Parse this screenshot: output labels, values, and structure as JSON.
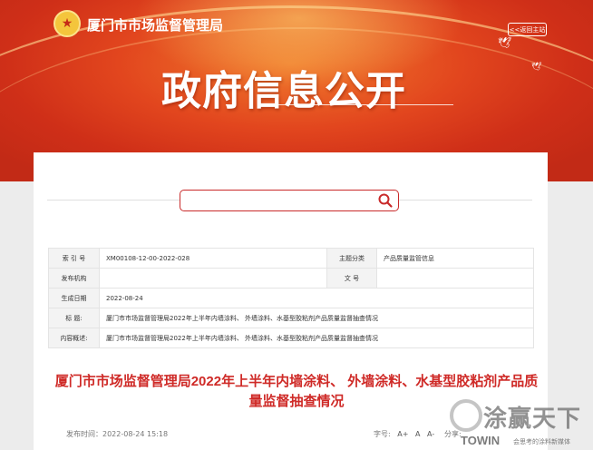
{
  "header": {
    "site_name": "厦门市市场监督管理局",
    "back_label": "<<返回主站",
    "page_title": "政府信息公开"
  },
  "search": {
    "placeholder": ""
  },
  "info_table": {
    "rows": [
      {
        "k1": "索 引 号",
        "v1": "XM00108-12-00-2022-028",
        "k2": "主题分类",
        "v2": "产品质量监管信息"
      },
      {
        "k1": "发布机构",
        "v1": "",
        "k2": "文  号",
        "v2": ""
      },
      {
        "k1": "生成日期",
        "v1": "2022-08-24"
      },
      {
        "k1": "标  题:",
        "v1": "厦门市市场监督管理局2022年上半年内墙涂料、 外墙涂料、水基型胶粘剂产品质量监督抽查情况"
      },
      {
        "k1": "内容概述:",
        "v1": "厦门市市场监督管理局2022年上半年内墙涂料、 外墙涂料、水基型胶粘剂产品质量监督抽查情况"
      }
    ]
  },
  "article": {
    "title": "厦门市市场监督管理局2022年上半年内墙涂料、 外墙涂料、水基型胶粘剂产品质量监督抽查情况",
    "publish_time": "发布时间：2022-08-24 15:18",
    "font_label": "字号:",
    "font_sizes": [
      "A+",
      "A",
      "A-"
    ],
    "share_label": "分享:"
  },
  "watermark": {
    "text": "涂赢天下",
    "brand": "TOWIN",
    "slogan": "会思考的涂料新媒体"
  },
  "colors": {
    "accent": "#cf2a27",
    "banner": "#e2461e"
  }
}
